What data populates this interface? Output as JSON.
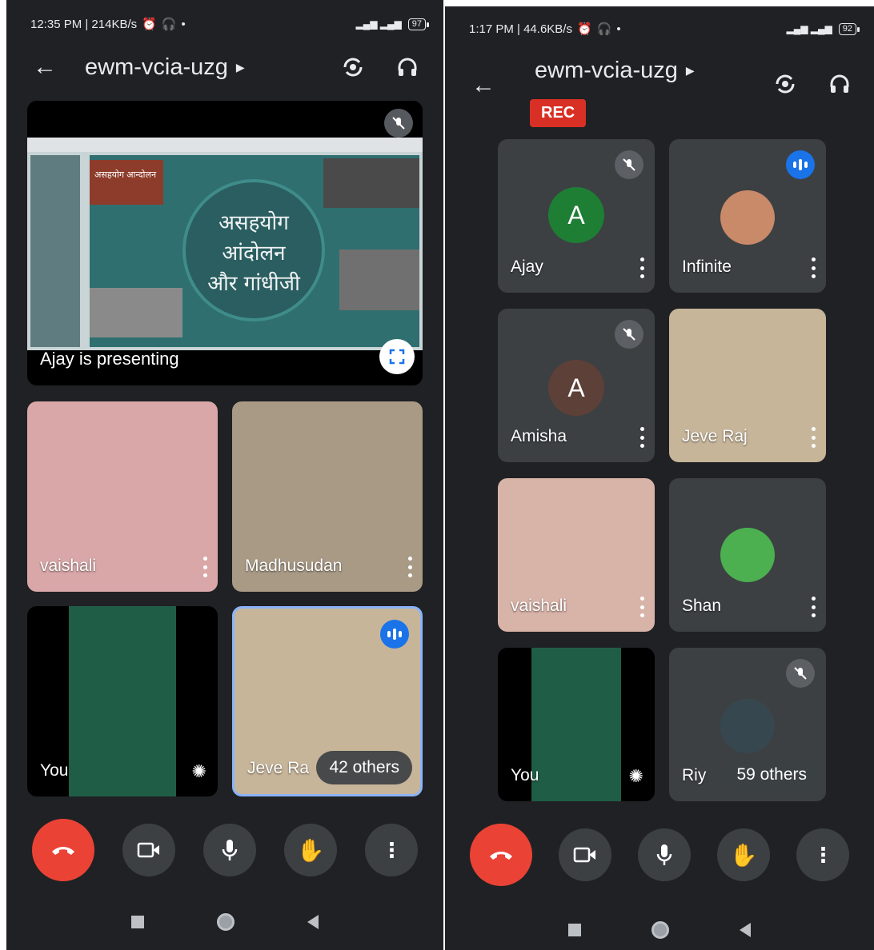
{
  "left": {
    "status": {
      "time_speed": "12:35 PM | 214KB/s",
      "battery": "97"
    },
    "meeting_code": "ewm-vcia-uzg",
    "presentation": {
      "label": "Ajay is presenting",
      "slide_lines": [
        "असहयोग",
        "आंदोलन",
        "और गांधीजी"
      ],
      "thumb_caption": "असहयोग आन्दोलन"
    },
    "tiles": [
      {
        "name": "vaishali"
      },
      {
        "name": "Madhusudan"
      },
      {
        "name": "You"
      },
      {
        "name": "Jeve Ra",
        "others": "42 others"
      }
    ]
  },
  "right": {
    "status": {
      "time_speed": "1:17 PM | 44.6KB/s",
      "battery": "92"
    },
    "meeting_code": "ewm-vcia-uzg",
    "rec_label": "REC",
    "tiles": [
      {
        "name": "Ajay",
        "letter": "A"
      },
      {
        "name": "Infinite"
      },
      {
        "name": "Amisha",
        "letter": "A"
      },
      {
        "name": "Jeve Raj"
      },
      {
        "name": "vaishali"
      },
      {
        "name": "Shan"
      },
      {
        "name": "You"
      },
      {
        "name": "Riy",
        "others": "59 others"
      }
    ]
  },
  "colors": {
    "accent": "#1a73e8",
    "end_call": "#ea4335",
    "tile_bg": "#3c4043",
    "ajay_avatar": "#1e7e34",
    "amisha_avatar": "#5d4037"
  }
}
